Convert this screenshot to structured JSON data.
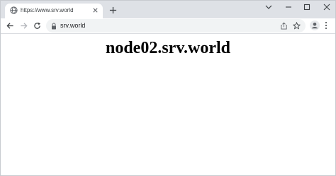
{
  "tab": {
    "title": "https://www.srv.world",
    "favicon": "globe-icon"
  },
  "toolbar": {
    "url": "srv.world"
  },
  "page": {
    "heading": "node02.srv.world"
  },
  "icons": {
    "tab_close": "close-icon",
    "new_tab": "plus-icon",
    "tab_search": "chevron-down-icon",
    "minimize": "minimize-icon",
    "maximize": "maximize-icon",
    "close_window": "close-icon",
    "back": "back-arrow-icon",
    "forward": "forward-arrow-icon",
    "reload": "reload-icon",
    "lock": "lock-icon",
    "share": "share-icon",
    "bookmark": "star-icon",
    "profile": "profile-icon",
    "menu": "kebab-menu-icon"
  },
  "colors": {
    "tabstrip_bg": "#dee1e6",
    "omnibox_bg": "#f1f3f4",
    "text": "#202124"
  }
}
